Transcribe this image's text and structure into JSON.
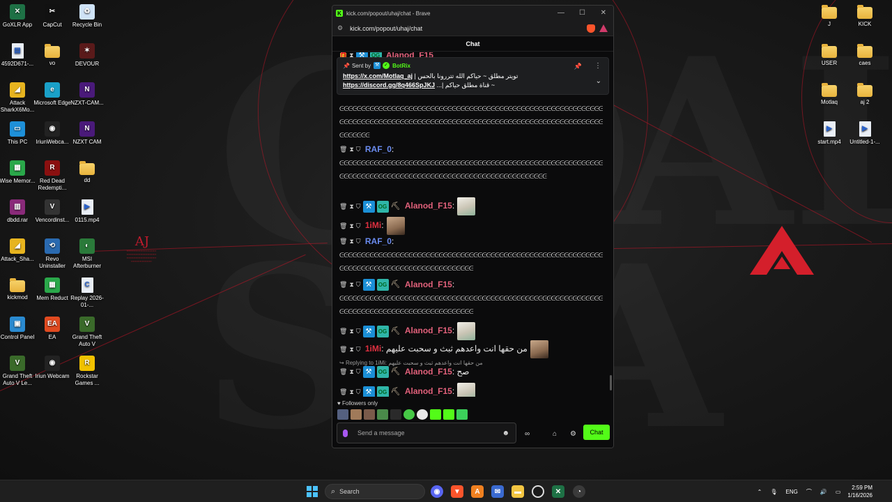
{
  "desktop_left": [
    {
      "label": "GoXLR App",
      "icon": "goxlr-icon"
    },
    {
      "label": "CapCut",
      "icon": "capcut-icon"
    },
    {
      "label": "Recycle Bin",
      "icon": "recycle-bin-icon"
    },
    {
      "label": "4592D671-...",
      "icon": "file-icon"
    },
    {
      "label": "vo",
      "icon": "folder-icon"
    },
    {
      "label": "DEVOUR",
      "icon": "devour-icon"
    },
    {
      "label": "Attack SharkX6Mo...",
      "icon": "attack-shark-icon"
    },
    {
      "label": "Microsoft Edge",
      "icon": "edge-icon"
    },
    {
      "label": "NZXT-CAM...",
      "icon": "nzxt-icon"
    },
    {
      "label": "This PC",
      "icon": "monitor-icon"
    },
    {
      "label": "IriunWebca...",
      "icon": "iriun-icon"
    },
    {
      "label": "NZXT CAM",
      "icon": "nzxt-icon"
    },
    {
      "label": "Wise Memor...",
      "icon": "wise-memory-icon"
    },
    {
      "label": "Red Dead Redempti...",
      "icon": "red-dead-icon"
    },
    {
      "label": "dd",
      "icon": "folder-icon"
    },
    {
      "label": "dbdd.rar",
      "icon": "winrar-icon"
    },
    {
      "label": "Vencordinst...",
      "icon": "vencord-icon"
    },
    {
      "label": "0115.mp4",
      "icon": "video-file-icon"
    },
    {
      "label": "Attack_Sha...",
      "icon": "attack-shark-icon"
    },
    {
      "label": "Revo Uninstaller",
      "icon": "revo-icon"
    },
    {
      "label": "MSI Afterburner",
      "icon": "msi-afterburner-icon"
    },
    {
      "label": "kickmod",
      "icon": "folder-icon"
    },
    {
      "label": "Mem Reduct",
      "icon": "mem-reduct-icon"
    },
    {
      "label": "Replay 2026-01-...",
      "icon": "replay-file-icon"
    },
    {
      "label": "Control Panel",
      "icon": "control-panel-icon"
    },
    {
      "label": "EA",
      "icon": "ea-icon"
    },
    {
      "label": "Grand Theft Auto V",
      "icon": "gta-icon"
    },
    {
      "label": "Grand Theft Auto V Le...",
      "icon": "gta-icon"
    },
    {
      "label": "Iriun Webcam",
      "icon": "iriun-icon"
    },
    {
      "label": "Rockstar Games ...",
      "icon": "rockstar-icon"
    }
  ],
  "desktop_right": [
    {
      "label": "J",
      "icon": "folder-icon"
    },
    {
      "label": "KICK",
      "icon": "folder-icon"
    },
    {
      "label": "USER",
      "icon": "folder-icon"
    },
    {
      "label": "caes",
      "icon": "folder-icon"
    },
    {
      "label": "Motlaq",
      "icon": "folder-icon"
    },
    {
      "label": "aj 2",
      "icon": "folder-icon"
    },
    {
      "label": "start.mp4",
      "icon": "video-file-icon"
    },
    {
      "label": "Untitled-1-...",
      "icon": "video-file-icon"
    }
  ],
  "wallpaper": {
    "aj_text": "AJ",
    "letters_left": "CO",
    "letters_right": "ALE",
    "letters_bottom": "SRA"
  },
  "browser": {
    "title": "kick.com/popout/uhaj/chat - Brave",
    "url": "kick.com/popout/uhaj/chat",
    "minimize": "—",
    "maximize": "☐",
    "close": "✕"
  },
  "chat": {
    "header": "Chat",
    "pinned": {
      "sent_by": "Sent by",
      "sender": "BotRix",
      "line1_link": "https://x.com/Motlaq_aj",
      "line1_text": "تويتر مطلق ~ حياكم الله تتررونا بالحس |",
      "line2_link": "https://discord.gg/8q466SpJKJ",
      "line2_text": "~ قناة مطلق حياكم |...",
      "pin_icon": "📌",
      "more_icon": "⋮",
      "expand_icon": "⌄"
    },
    "spam_text_a": "ᕮᕮᕮᕮᕮᕮᕮᕮᕮᕮᕮᕮᕮᕮᕮᕮᕮᕮᕮᕮᕮᕮᕮᕮᕮᕮᕮᕮᕮᕮᕮᕮᕮᕮᕮᕮᕮᕮᕮᕮᕮᕮᕮᕮᕮᕮᕮᕮᕮᕮᕮᕮᕮᕮᕮᕮᕮᕮᕮᕮᕮᕮᕮᕮᕮᕮᕮᕮᕮᕮᕮᕮᕮᕮᕮᕮᕮᕮᕮᕮᕮᕮᕮᕮᕮᕮᕮᕮᕮᕮᕮᕮᕮᕮᕮᕮᕮᕮᕮᕮᕮᕮᕮᕮᕮᕮᕮᕮᕮᕮᕮᕮᕮᕮᕮᕮᕮᕮᕮᕮᕮᕮᕮᕮᕮᕮᕮᕮᕮ",
    "spam_text_b": "ᕮᕮᕮᕮᕮᕮᕮᕮᕮᕮᕮᕮᕮᕮᕮᕮᕮᕮᕮᕮᕮᕮᕮᕮᕮᕮᕮᕮᕮᕮᕮᕮᕮᕮᕮᕮᕮᕮᕮᕮᕮᕮᕮᕮᕮᕮᕮᕮᕮᕮᕮᕮᕮᕮᕮᕮᕮᕮᕮᕮᕮᕮᕮᕮᕮᕮᕮᕮᕮᕮᕮᕮᕮᕮᕮᕮᕮᕮᕮᕮᕮᕮᕮᕮᕮᕮᕮᕮᕮᕮᕮᕮᕮᕮᕮᕮᕮᕮᕮᕮᕮᕮᕮᕮᕮᕮᕮᕮᕮ",
    "spam_text_c": "ᕮᕮᕮᕮᕮᕮᕮᕮᕮᕮᕮᕮᕮᕮᕮᕮᕮᕮᕮᕮᕮᕮᕮᕮᕮᕮᕮᕮᕮᕮᕮᕮᕮᕮᕮᕮᕮᕮᕮᕮᕮᕮᕮᕮᕮᕮᕮᕮᕮᕮᕮᕮᕮᕮᕮᕮᕮᕮᕮᕮᕮᕮᕮᕮᕮᕮᕮᕮᕮᕮᕮᕮᕮᕮᕮᕮᕮᕮᕮᕮᕮᕮᕮᕮᕮᕮᕮᕮᕮᕮᕮᕮ",
    "users": {
      "alanod": "Alanod_F15",
      "raf": "RAF_0",
      "imi": "1iMi"
    },
    "message_arabic": "من حقها انت واعدهم ثبث و سحبت عليهم",
    "reply_label": "Replying to 1iMi:",
    "reply_preview": "من حقها انت واعدهم ثبث و سحبت عليهم",
    "reply_text": "صح",
    "name_colors": {
      "alanod": "#e0607a",
      "raf": "#6b8cf0",
      "imi": "#e03040"
    },
    "followers_only": "Followers only",
    "input_placeholder": "Send a message",
    "send_button": "Chat"
  },
  "taskbar": {
    "search": "Search",
    "lang": "ENG",
    "time": "2:59 PM",
    "date": "1/16/2026"
  },
  "colors": {
    "kick_green": "#53fc18",
    "brave_orange": "#fb542b",
    "accent_red": "#c21b2d"
  }
}
